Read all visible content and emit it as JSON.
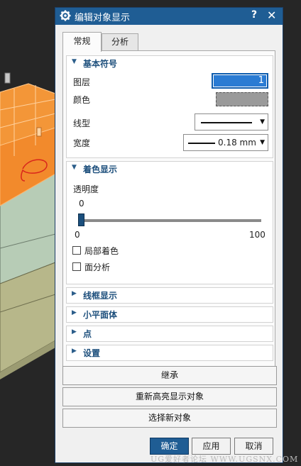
{
  "dialog": {
    "title": "编辑对象显示",
    "help": "?",
    "close": "✕"
  },
  "tabs": [
    {
      "label": "常规",
      "active": true
    },
    {
      "label": "分析",
      "active": false
    }
  ],
  "basic_symbol": {
    "header": "基本符号",
    "layer_label": "图层",
    "layer_value": "1",
    "color_label": "颜色",
    "color_value": "#9a9a9a",
    "linetype_label": "线型",
    "width_label": "宽度",
    "width_value": "0.18 mm"
  },
  "shading": {
    "header": "着色显示",
    "transparency_label": "透明度",
    "transparency_value": "0",
    "slider_min": "0",
    "slider_max": "100",
    "slider_fraction": 0,
    "local_shading_label": "局部着色",
    "face_analysis_label": "面分析"
  },
  "collapsed_sections": [
    "线框显示",
    "小平面体",
    "点",
    "设置"
  ],
  "buttons": {
    "inherit": "继承",
    "reselect_highlight": "重新高亮显示对象",
    "select_new": "选择新对象",
    "ok": "确定",
    "apply": "应用",
    "cancel": "取消"
  },
  "watermark": "UG爱好者论坛 WWW.UGSNX.COM",
  "colors": {
    "title_bar": "#1f5d94",
    "accent": "#1d4f7c",
    "model_orange": "#f28a2c",
    "model_green": "#b8cdb8",
    "model_olive": "#b9b98a"
  }
}
